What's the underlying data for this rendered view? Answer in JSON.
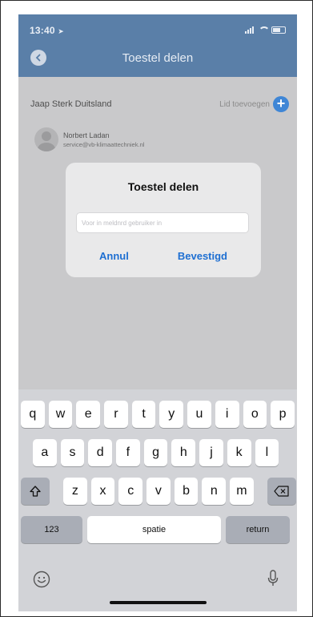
{
  "status_bar": {
    "time": "13:40"
  },
  "header": {
    "title": "Toestel delen"
  },
  "content": {
    "group_name": "Jaap Sterk Duitsland",
    "add_member_label": "Lid toevoegen",
    "member": {
      "name": "Norbert Ladan",
      "email": "service@vb-klimaattechniek.nl"
    }
  },
  "dialog": {
    "title": "Toestel delen",
    "input_placeholder": "Voor in meldnrd gebruiker in",
    "cancel_label": "Annul",
    "confirm_label": "Bevestigd"
  },
  "keyboard": {
    "row1": [
      "q",
      "w",
      "e",
      "r",
      "t",
      "y",
      "u",
      "i",
      "o",
      "p"
    ],
    "row2": [
      "a",
      "s",
      "d",
      "f",
      "g",
      "h",
      "j",
      "k",
      "l"
    ],
    "row3": [
      "z",
      "x",
      "c",
      "v",
      "b",
      "n",
      "m"
    ],
    "numbers_label": "123",
    "space_label": "spatie",
    "return_label": "return"
  },
  "colors": {
    "accent": "#1e6fd2",
    "header": "#5a7fa8",
    "plus": "#3f86d6"
  }
}
